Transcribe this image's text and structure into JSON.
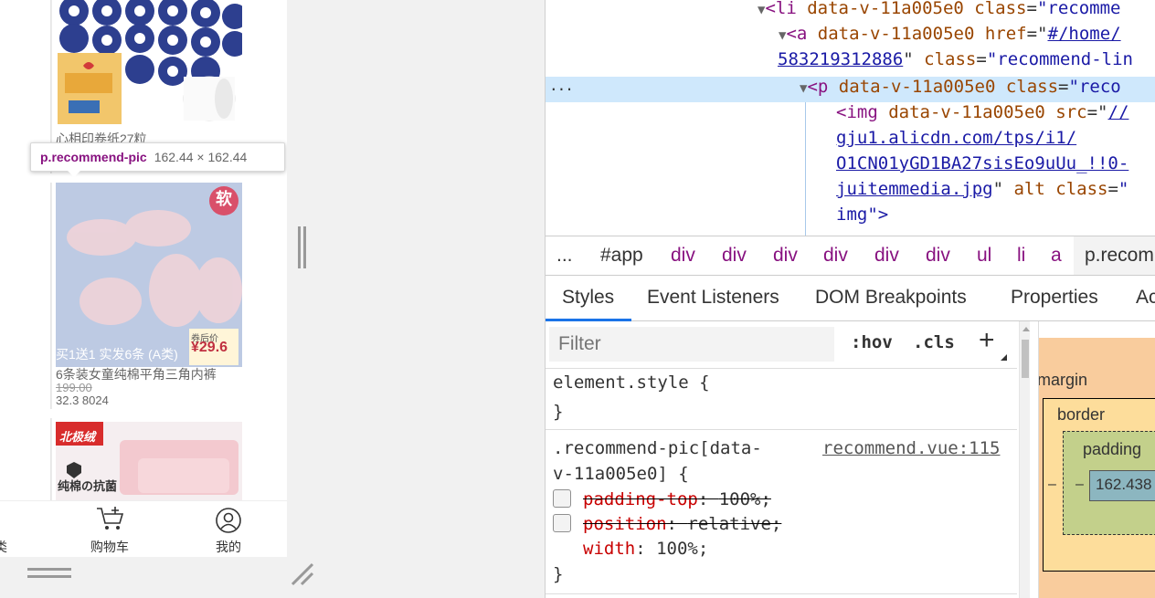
{
  "preview": {
    "product1": {
      "name": "心相印卷纸27粒"
    },
    "tooltip": {
      "selector": "p.recommend-pic",
      "size": "162.44 × 162.44"
    },
    "product2": {
      "badge": "软",
      "promo": "买1送1 实发6条 (A类)",
      "price_tag_label": "券后价",
      "price_tag_value": "¥29.6",
      "name": "6条装女童纯棉平角三角内裤",
      "orig_price": "199.00",
      "sale_info": "32.3 8024"
    },
    "product3": {
      "brand": "北极绒",
      "label": "纯棉の抗菌"
    },
    "tabbar": [
      {
        "label": "类",
        "icon": "grid-icon"
      },
      {
        "label": "购物车",
        "icon": "cart-icon"
      },
      {
        "label": "我的",
        "icon": "user-icon"
      }
    ]
  },
  "elements": {
    "line1": {
      "tag": "li",
      "attr1": "data-v-11a005e0",
      "attr2": "class",
      "val2": "\"recomme"
    },
    "line2": {
      "tag": "a",
      "attr1": "data-v-11a005e0",
      "attr2": "href",
      "val2": "#/home/"
    },
    "line3": {
      "link": "583219312886",
      "attr": "class",
      "val": "\"recommend-lin"
    },
    "line4": {
      "tag": "p",
      "attr1": "data-v-11a005e0",
      "attr2": "class",
      "val2": "\"reco"
    },
    "line5": {
      "tag": "img",
      "attr1": "data-v-11a005e0",
      "attr2": "src",
      "val2": "//"
    },
    "line6": {
      "link": "gju1.alicdn.com/tps/i1/"
    },
    "line7": {
      "link": "O1CN01yGD1BA27sisEo9uUu_!!0-"
    },
    "line8": {
      "link": "juitemmedia.jpg",
      "attr": "alt",
      "attr2": "class",
      "val": "\""
    },
    "line9": {
      "text": "img\">"
    },
    "ellipsis": "..."
  },
  "breadcrumbs": [
    "...",
    "#app",
    "div",
    "div",
    "div",
    "div",
    "div",
    "div",
    "ul",
    "li",
    "a",
    "p.recom"
  ],
  "tabs": [
    "Styles",
    "Event Listeners",
    "DOM Breakpoints",
    "Properties",
    "Ac"
  ],
  "styles": {
    "filter_placeholder": "Filter",
    "hov": ":hov",
    "cls": ".cls",
    "plus": "+",
    "element_style": "element.style {",
    "close_brace": "}",
    "rule_selector_1": ".recommend-pic[data-",
    "rule_selector_2": "v-11a005e0] {",
    "rule_source": "recommend.vue:115",
    "props": [
      {
        "name": "padding-top",
        "value": "100%;",
        "struck": true
      },
      {
        "name": "position",
        "value": "relative;",
        "struck": true
      },
      {
        "name": "width",
        "value": "100%;",
        "struck": false
      }
    ]
  },
  "box_model": {
    "margin": "margin",
    "border": "border",
    "padding": "padding",
    "dash": "–",
    "content": "162.438"
  }
}
